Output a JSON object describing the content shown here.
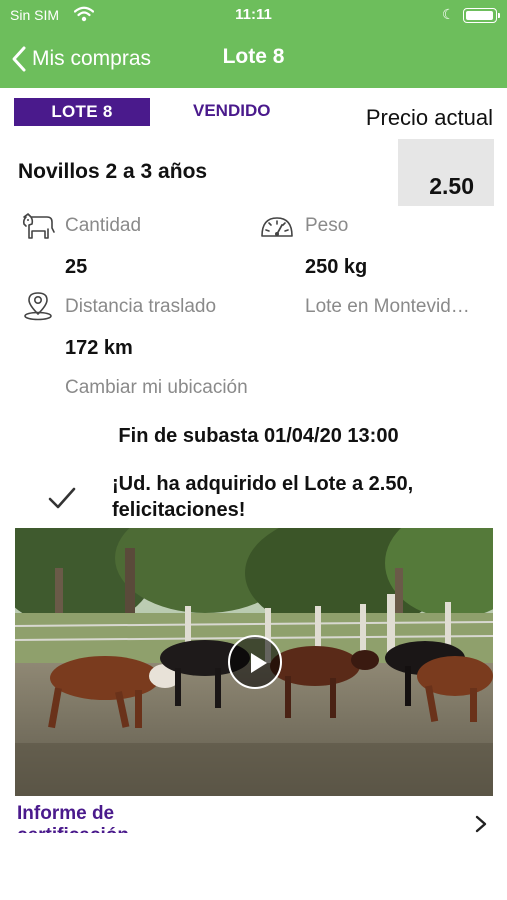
{
  "status_bar": {
    "carrier": "Sin SIM",
    "time": "11:11",
    "icons": [
      "wifi-icon",
      "moon-icon",
      "battery-icon"
    ]
  },
  "nav": {
    "back_label": "Mis compras",
    "title": "Lote 8"
  },
  "lot": {
    "badge": "LOTE 8",
    "status": "VENDIDO",
    "price_label": "Precio actual",
    "price_value": "2.50",
    "name": "Novillos 2 a 3 años"
  },
  "details": {
    "quantity_label": "Cantidad",
    "quantity_value": "25",
    "weight_label": "Peso",
    "weight_value": "250 kg",
    "distance_label": "Distancia traslado",
    "distance_value": "172 km",
    "location_label": "Lote en Montevid…",
    "change_location": "Cambiar mi ubicación"
  },
  "auction_end": "Fin de subasta 01/04/20 13:00",
  "congrats": "¡Ud. ha adquirido el Lote a 2.50, felicitaciones!",
  "report_link": "Informe de certificación",
  "colors": {
    "header_green": "#6dbe5c",
    "brand_purple": "#4a1a8c",
    "price_box_gray": "#e6e6e6",
    "label_gray": "#8a8a8a"
  }
}
